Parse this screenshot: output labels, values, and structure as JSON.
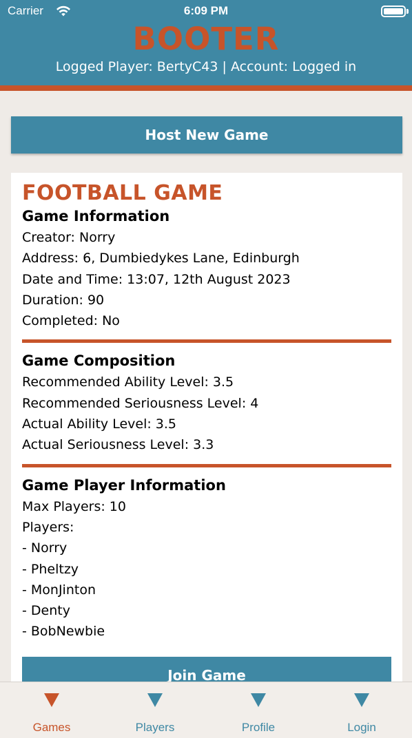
{
  "status_bar": {
    "carrier": "Carrier",
    "time": "6:09 PM"
  },
  "header": {
    "brand": "BOOTER",
    "logged_info": "Logged Player: BertyC43 | Account: Logged in"
  },
  "host_button": {
    "label": "Host New Game"
  },
  "game_card": {
    "title": "FOOTBALL GAME",
    "info": {
      "heading": "Game Information",
      "creator": "Creator: Norry",
      "address": "Address: 6, Dumbiedykes Lane, Edinburgh",
      "datetime": "Date and Time: 13:07, 12th August 2023",
      "duration": "Duration: 90",
      "completed": "Completed: No"
    },
    "composition": {
      "heading": "Game Composition",
      "rec_ability": "Recommended Ability Level: 3.5",
      "rec_serious": "Recommended Seriousness Level: 4",
      "act_ability": "Actual Ability Level: 3.5",
      "act_serious": "Actual Seriousness Level: 3.3"
    },
    "players": {
      "heading": "Game Player Information",
      "max": "Max Players: 10",
      "label": "Players:",
      "list": [
        "- Norry",
        "- Pheltzy",
        "- MonJinton",
        "- Denty",
        "- BobNewbie"
      ]
    },
    "join_label": "Join Game"
  },
  "tabs": [
    {
      "label": "Games",
      "active": true
    },
    {
      "label": "Players",
      "active": false
    },
    {
      "label": "Profile",
      "active": false
    },
    {
      "label": "Login",
      "active": false
    }
  ],
  "colors": {
    "primary_blue": "#3f88a4",
    "accent_orange": "#c7542a",
    "background": "#efebe7"
  }
}
